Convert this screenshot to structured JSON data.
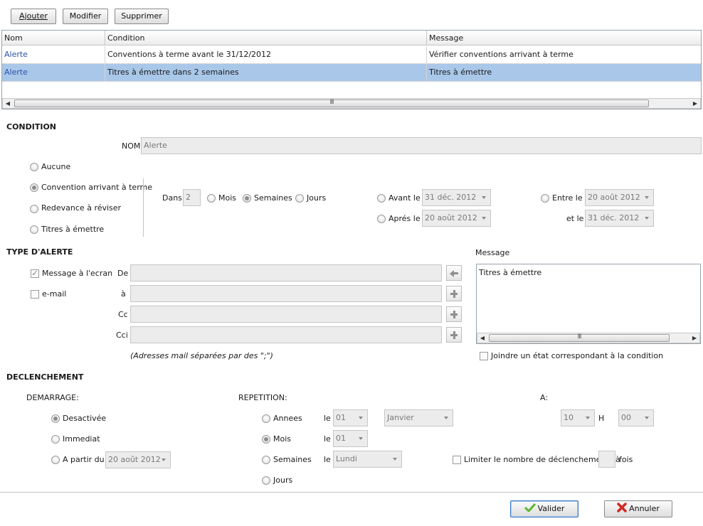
{
  "toolbar": {
    "add": "Ajouter",
    "edit": "Modifier",
    "delete": "Supprimer"
  },
  "grid": {
    "columns": [
      "Nom",
      "Condition",
      "Message"
    ],
    "rows": [
      {
        "name": "Alerte",
        "condition": "Conventions à terme avant le 31/12/2012",
        "message": "Vérifier conventions arrivant à terme",
        "selected": false
      },
      {
        "name": "Alerte",
        "condition": "Titres à émettre dans 2 semaines",
        "message": "Titres à émettre",
        "selected": true
      }
    ],
    "scroll_grip": "III"
  },
  "condition": {
    "title": "CONDITION",
    "nom_label": "NOM",
    "nom_value": "Alerte",
    "options": [
      "Aucune",
      "Convention arrivant à terme",
      "Redevance à réviser",
      "Titres à émettre"
    ],
    "selected_option": "Convention arrivant à terme",
    "dans_label": "Dans",
    "dans_value": "2",
    "unit_mois": "Mois",
    "unit_semaines": "Semaines",
    "unit_jours": "Jours",
    "selected_unit": "Semaines",
    "avant_label": "Avant le",
    "avant_value": "31 déc. 2012",
    "apres_label": "Aprés le",
    "apres_value": "20 août 2012",
    "entre_label": "Entre le",
    "entre_value": "20 août 2012",
    "et_label": "et le",
    "et_value": "31 déc. 2012"
  },
  "alert_type": {
    "title": "TYPE D'ALERTE",
    "screen_message": "Message à l'ecran",
    "email": "e-mail",
    "de": "De",
    "a": "à",
    "cc": "Cc",
    "cci": "Cci",
    "hint": "(Adresses mail séparées par des \";\")",
    "message_label": "Message",
    "message_value": "Titres à émettre",
    "attach_label": "Joindre un état correspondant à la condition"
  },
  "trigger": {
    "title": "DECLENCHEMENT",
    "start_label": "DEMARRAGE:",
    "start_options": [
      "Desactivée",
      "Immediat",
      "A partir du"
    ],
    "start_selected": "Desactivée",
    "start_date": "20 août 2012",
    "repeat_label": "REPETITION:",
    "repeat_annees": "Annees",
    "repeat_mois": "Mois",
    "repeat_semaines": "Semaines",
    "repeat_jours": "Jours",
    "repeat_selected": "Mois",
    "le": "le",
    "annees_day": "01",
    "annees_month": "Janvier",
    "mois_day": "01",
    "semaines_day": "Lundi",
    "at_label": "A:",
    "hour": "10",
    "h_label": "H",
    "minute": "00",
    "limit_label": "Limiter le nombre de déclenchements à",
    "limit_value": "",
    "fois": "fois"
  },
  "footer": {
    "ok": "Valider",
    "cancel": "Annuler"
  },
  "colors": {
    "selection": "#a9c7e9",
    "link": "#2a52a8",
    "ok_icon": "#5cb82e",
    "cancel_icon": "#d12a22"
  }
}
